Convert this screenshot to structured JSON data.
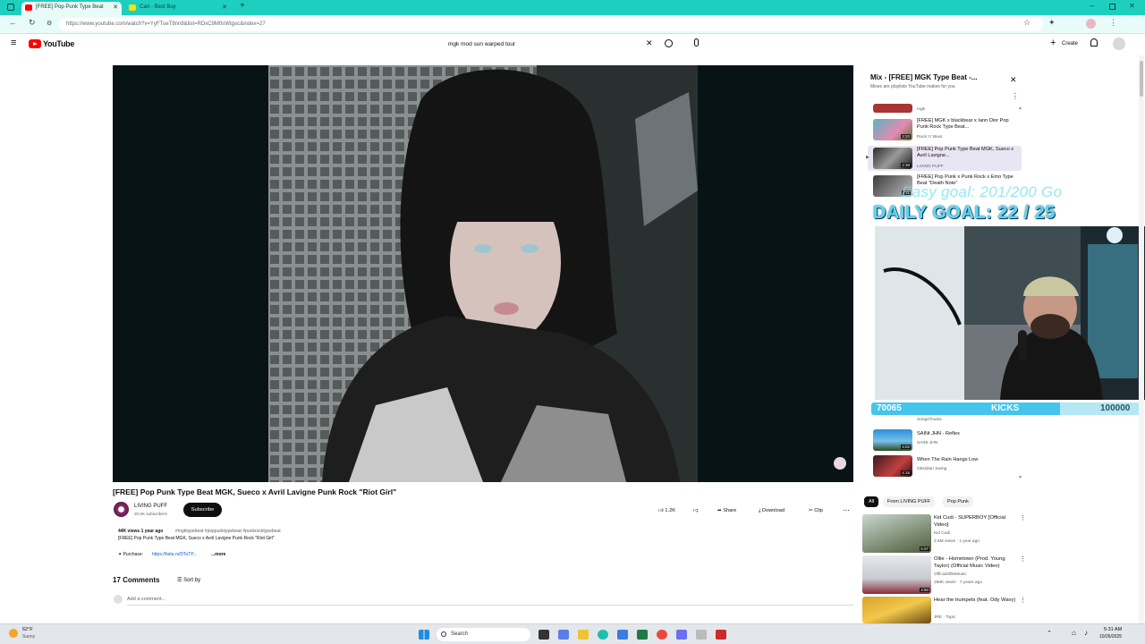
{
  "browser": {
    "tabs": [
      {
        "label": "[FREE] Pop Punk Type Beat",
        "active": true
      },
      {
        "label": "Cart - Best Buy",
        "active": false
      }
    ],
    "address": "https://www.youtube.com/watch?v=YyFTueT8nn8&list=RDxC9M0sWtgoc&index=27"
  },
  "youtube": {
    "logo_text": "YouTube",
    "search_value": "mgk mod sun warped tour",
    "create_label": "Create"
  },
  "video": {
    "title": "[FREE] Pop Punk Type Beat MGK, Sueco x Avril Lavigne Punk Rock \"Riot Girl\"",
    "channel": "LIVING PUFF",
    "subscribers": "20.5K subscribers",
    "subscribe_label": "Subscribe",
    "likes": "1.2K",
    "share_label": "Share",
    "download_label": "Download",
    "clip_label": "Clip",
    "views_line": "44K views  1 year ago",
    "hashtags": "#mgktypebeat #poppunktypebeat #punkrocktypebeat",
    "desc_line": "[FREE] Pop Punk Type Beat MGK, Sueco x Avril Lavigne Punk Rock \"Riot Girl\"",
    "purchase_label": "✦ Purchase:",
    "purchase_link": "https://bsta.rs/DToTP...",
    "more_label": "...more",
    "comments_count": "17 Comments",
    "sort_label": "Sort by",
    "add_comment": "Add a comment..."
  },
  "playlist": {
    "title": "Mix - [FREE] MGK Type Beat -...",
    "subtitle": "Mixes are playlists YouTube makes for you",
    "top_fragment": "mgk",
    "items": [
      {
        "title": "[FREE] MGK x blackbear x Iann Dior Pop Punk Rock Type Beat...",
        "channel": "Rock 'n' Beat",
        "duration": "3:20"
      },
      {
        "title": "[FREE] Pop Punk Type Beat MGK, Sueco x Avril Lavigne...",
        "channel": "LIVING PUFF",
        "duration": "2:38"
      },
      {
        "title": "[FREE] Pop Punk x Punk Rock x Emo Type Beat \"Death Note\"",
        "channel": "",
        "duration": "2:11"
      },
      {
        "title": "SAINt JHN - Reflex",
        "channel": "SAINt JHN",
        "duration": "4:02"
      },
      {
        "title": "When The Rain Hangs Low",
        "channel": "Obsidian Swing",
        "duration": "4:16"
      }
    ],
    "hidden_fragment": "SongsTracks"
  },
  "overlay": {
    "goal_faint": "Easy goal: 201/200 Go",
    "goal_main": "DAILY GOAL: 22 / 25",
    "kicks_current": "70065",
    "kicks_label": "KICKS",
    "kicks_target": "100000",
    "kicks_progress": 0.7
  },
  "chips": [
    "All",
    "From LIVING PUFF",
    "Pop Punk"
  ],
  "recommendations": [
    {
      "title": "Kid Cudi - SUPERBOY [Official Video]",
      "channel": "Kid Cudi",
      "meta": "2.5M views · 1 year ago",
      "duration": "5:07"
    },
    {
      "title": "Ollie - Hometown (Prod. Young Taylor) (Official Music Video)",
      "channel": "OfficialOllieMusic",
      "meta": "266K views · 7 years ago",
      "duration": "3:50"
    },
    {
      "title": "Hear the trumpets (feat. Ody Wavy)",
      "channel": "JRE · Topic",
      "meta": "",
      "duration": ""
    }
  ],
  "taskbar": {
    "weather_temp": "62°F",
    "weather_desc": "Sunny",
    "search_placeholder": "Search",
    "time": "5:31 AM",
    "date": "10/26/2025"
  },
  "colors": {
    "browser_accent": "#1ecfc0",
    "yt_red": "#ff0000",
    "overlay_cyan": "#45c5ec"
  }
}
